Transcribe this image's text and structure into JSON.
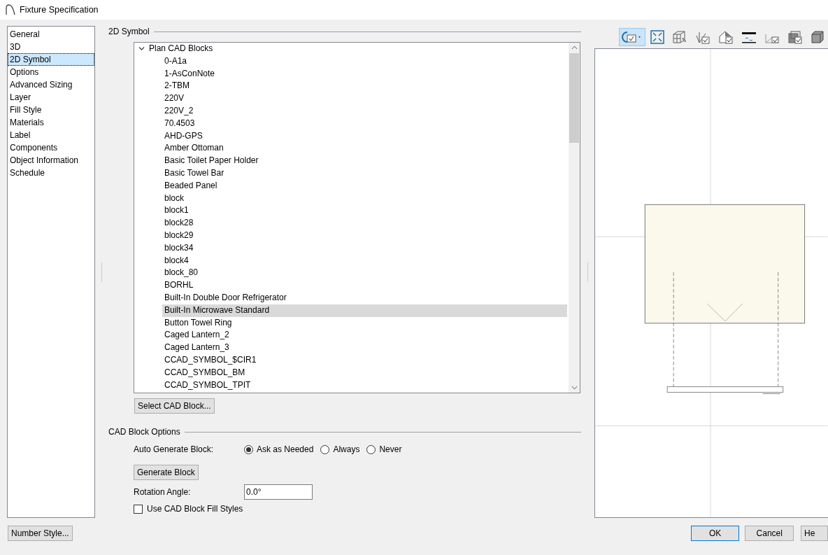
{
  "window": {
    "title": "Fixture Specification"
  },
  "nav": [
    {
      "label": "General",
      "selected": false
    },
    {
      "label": "3D",
      "selected": false
    },
    {
      "label": "2D Symbol",
      "selected": true
    },
    {
      "label": "Options",
      "selected": false
    },
    {
      "label": "Advanced Sizing",
      "selected": false
    },
    {
      "label": "Layer",
      "selected": false
    },
    {
      "label": "Fill Style",
      "selected": false
    },
    {
      "label": "Materials",
      "selected": false
    },
    {
      "label": "Label",
      "selected": false
    },
    {
      "label": "Components",
      "selected": false
    },
    {
      "label": "Object Information",
      "selected": false
    },
    {
      "label": "Schedule",
      "selected": false
    }
  ],
  "symbol_group": {
    "title": "2D Symbol",
    "tree": {
      "label": "Plan CAD Blocks",
      "expanded": true,
      "children": [
        {
          "label": "0-A1a",
          "selected": false
        },
        {
          "label": "1-AsConNote",
          "selected": false
        },
        {
          "label": "2-TBM",
          "selected": false
        },
        {
          "label": "220V",
          "selected": false
        },
        {
          "label": "220V_2",
          "selected": false
        },
        {
          "label": "70.4503",
          "selected": false
        },
        {
          "label": "AHD-GPS",
          "selected": false
        },
        {
          "label": "Amber Ottoman",
          "selected": false
        },
        {
          "label": "Basic Toilet Paper Holder",
          "selected": false
        },
        {
          "label": "Basic Towel Bar",
          "selected": false
        },
        {
          "label": "Beaded Panel",
          "selected": false
        },
        {
          "label": "block",
          "selected": false
        },
        {
          "label": "block1",
          "selected": false
        },
        {
          "label": "block28",
          "selected": false
        },
        {
          "label": "block29",
          "selected": false
        },
        {
          "label": "block34",
          "selected": false
        },
        {
          "label": "block4",
          "selected": false
        },
        {
          "label": "block_80",
          "selected": false
        },
        {
          "label": "BORHL",
          "selected": false
        },
        {
          "label": "Built-In Double Door Refrigerator",
          "selected": false
        },
        {
          "label": "Built-In Microwave Standard",
          "selected": true
        },
        {
          "label": "Button Towel Ring",
          "selected": false
        },
        {
          "label": "Caged Lantern_2",
          "selected": false
        },
        {
          "label": "Caged Lantern_3",
          "selected": false
        },
        {
          "label": "CCAD_SYMBOL_$CIR1",
          "selected": false
        },
        {
          "label": "CCAD_SYMBOL_BM",
          "selected": false
        },
        {
          "label": "CCAD_SYMBOL_TPIT",
          "selected": false
        }
      ]
    },
    "select_button": "Select CAD Block..."
  },
  "options_group": {
    "title": "CAD Block Options",
    "auto_generate": {
      "label": "Auto Generate Block:",
      "options": [
        {
          "label": "Ask as Needed",
          "selected": true
        },
        {
          "label": "Always",
          "selected": false
        },
        {
          "label": "Never",
          "selected": false
        }
      ]
    },
    "generate_button": "Generate Block",
    "rotation": {
      "label": "Rotation Angle:",
      "value": "0.0°"
    },
    "fill_styles": {
      "label": "Use CAD Block Fill Styles",
      "checked": false
    }
  },
  "toolbar": [
    {
      "kind": "rotate",
      "selected": true
    },
    {
      "kind": "fit",
      "selected": false
    },
    {
      "kind": "cube-select",
      "selected": false
    },
    {
      "kind": "axes",
      "selected": false
    },
    {
      "kind": "house",
      "selected": false
    },
    {
      "kind": "flip",
      "selected": false
    },
    {
      "kind": "zy",
      "selected": false
    },
    {
      "kind": "layers",
      "selected": false
    },
    {
      "kind": "box",
      "selected": false
    }
  ],
  "footer": {
    "number_style": "Number Style...",
    "ok": "OK",
    "cancel": "Cancel",
    "help": "He"
  }
}
